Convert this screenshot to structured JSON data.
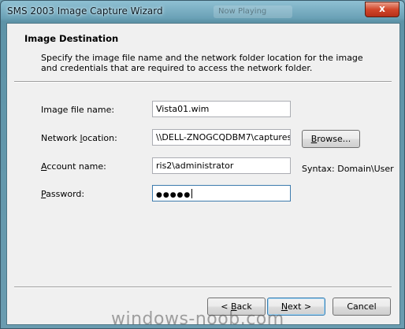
{
  "window": {
    "title": "SMS 2003 Image Capture Wizard",
    "background_tab": "Now Playing",
    "close_glyph": "x"
  },
  "header": {
    "title": "Image Destination",
    "description": "Specify the image file name and the network folder location for the image and credentials that are required to access the network folder."
  },
  "form": {
    "image_file_label": "Image file name:",
    "image_file_value": "Vista01.wim",
    "network_label_pre": "Network ",
    "network_label_key": "l",
    "network_label_post": "ocation:",
    "network_value": "\\\\DELL-ZNOGCQDBM7\\captures",
    "browse_key": "B",
    "browse_rest": "rowse...",
    "account_key": "A",
    "account_rest": "ccount name:",
    "account_value": "ris2\\administrator",
    "syntax_hint": "Syntax: Domain\\User",
    "password_key": "P",
    "password_rest": "assword:",
    "password_value": "●●●●●"
  },
  "footer": {
    "back_pre": "< ",
    "back_key": "B",
    "back_rest": "ack",
    "next_pre": "",
    "next_key": "N",
    "next_rest": "ext >",
    "cancel_label": "Cancel"
  },
  "watermark": "windows-noob.com",
  "colors": {
    "title_bar": "#6a9cb0",
    "close_button": "#d2472b",
    "client_bg": "#f0f0f0",
    "default_button_border": "#3c7fb1"
  }
}
